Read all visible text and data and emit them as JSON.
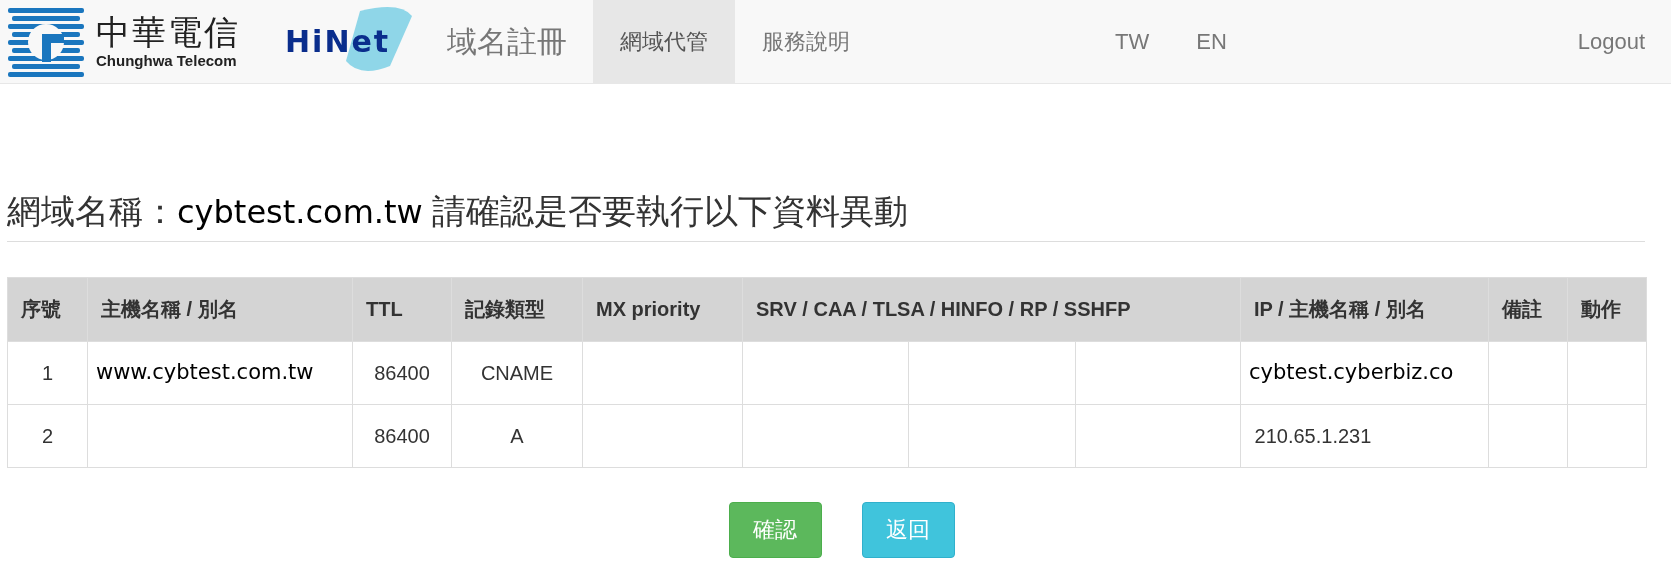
{
  "brand": {
    "name": "中華電信",
    "name_en": "Chunghwa Telecom",
    "product": "HiNet",
    "site_title": "域名註冊"
  },
  "nav": [
    {
      "label": "網域代管",
      "selected": true
    },
    {
      "label": "服務說明",
      "selected": false
    }
  ],
  "languages": [
    "TW",
    "EN"
  ],
  "logout": "Logout",
  "heading": {
    "label": "網域名稱：",
    "domain": "cybtest.com.tw",
    "message": "請確認是否要執行以下資料異動"
  },
  "table": {
    "columns": [
      "序號",
      "主機名稱 / 別名",
      "TTL",
      "記錄類型",
      "MX priority",
      "SRV / CAA / TLSA / HINFO / RP / SSHFP",
      "IP / 主機名稱 / 別名",
      "備註",
      "動作"
    ],
    "rows": [
      [
        "1",
        "www.cybtest.com.tw",
        "86400",
        "CNAME",
        "",
        "",
        "",
        "",
        "cybtest.cyberbiz.co",
        "",
        ""
      ],
      [
        "2",
        "",
        "86400",
        "A",
        "",
        "",
        "",
        "",
        " 210.65.1.231",
        "",
        ""
      ]
    ]
  },
  "buttons": [
    {
      "label": "確認",
      "kind": "confirm"
    },
    {
      "label": "返回",
      "kind": "back"
    }
  ]
}
